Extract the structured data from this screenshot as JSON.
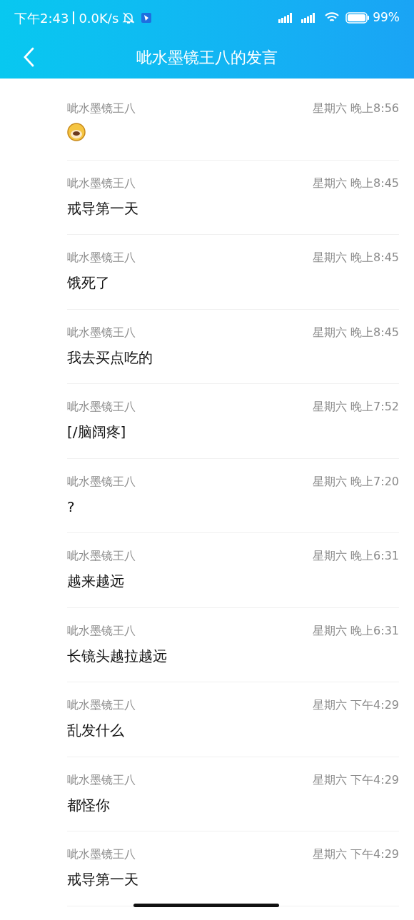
{
  "status_bar": {
    "time": "下午2:43",
    "speed": "0.0K/s",
    "battery": "99%"
  },
  "header": {
    "title": "呲水墨镜王八的发言"
  },
  "messages": [
    {
      "sender": "呲水墨镜王八",
      "time": "星期六 晚上8:56",
      "kind": "sticker"
    },
    {
      "sender": "呲水墨镜王八",
      "time": "星期六 晚上8:45",
      "kind": "text",
      "text": "戒导第一天"
    },
    {
      "sender": "呲水墨镜王八",
      "time": "星期六 晚上8:45",
      "kind": "text",
      "text": "饿死了"
    },
    {
      "sender": "呲水墨镜王八",
      "time": "星期六 晚上8:45",
      "kind": "text",
      "text": "我去买点吃的"
    },
    {
      "sender": "呲水墨镜王八",
      "time": "星期六 晚上7:52",
      "kind": "text",
      "text": "[/脑阔疼]"
    },
    {
      "sender": "呲水墨镜王八",
      "time": "星期六 晚上7:20",
      "kind": "text",
      "text": "?"
    },
    {
      "sender": "呲水墨镜王八",
      "time": "星期六 晚上6:31",
      "kind": "text",
      "text": "越来越远"
    },
    {
      "sender": "呲水墨镜王八",
      "time": "星期六 晚上6:31",
      "kind": "text",
      "text": "长镜头越拉越远"
    },
    {
      "sender": "呲水墨镜王八",
      "time": "星期六 下午4:29",
      "kind": "text",
      "text": "乱发什么"
    },
    {
      "sender": "呲水墨镜王八",
      "time": "星期六 下午4:29",
      "kind": "text",
      "text": "都怪你"
    },
    {
      "sender": "呲水墨镜王八",
      "time": "星期六 下午4:29",
      "kind": "text",
      "text": "戒导第一天"
    }
  ]
}
